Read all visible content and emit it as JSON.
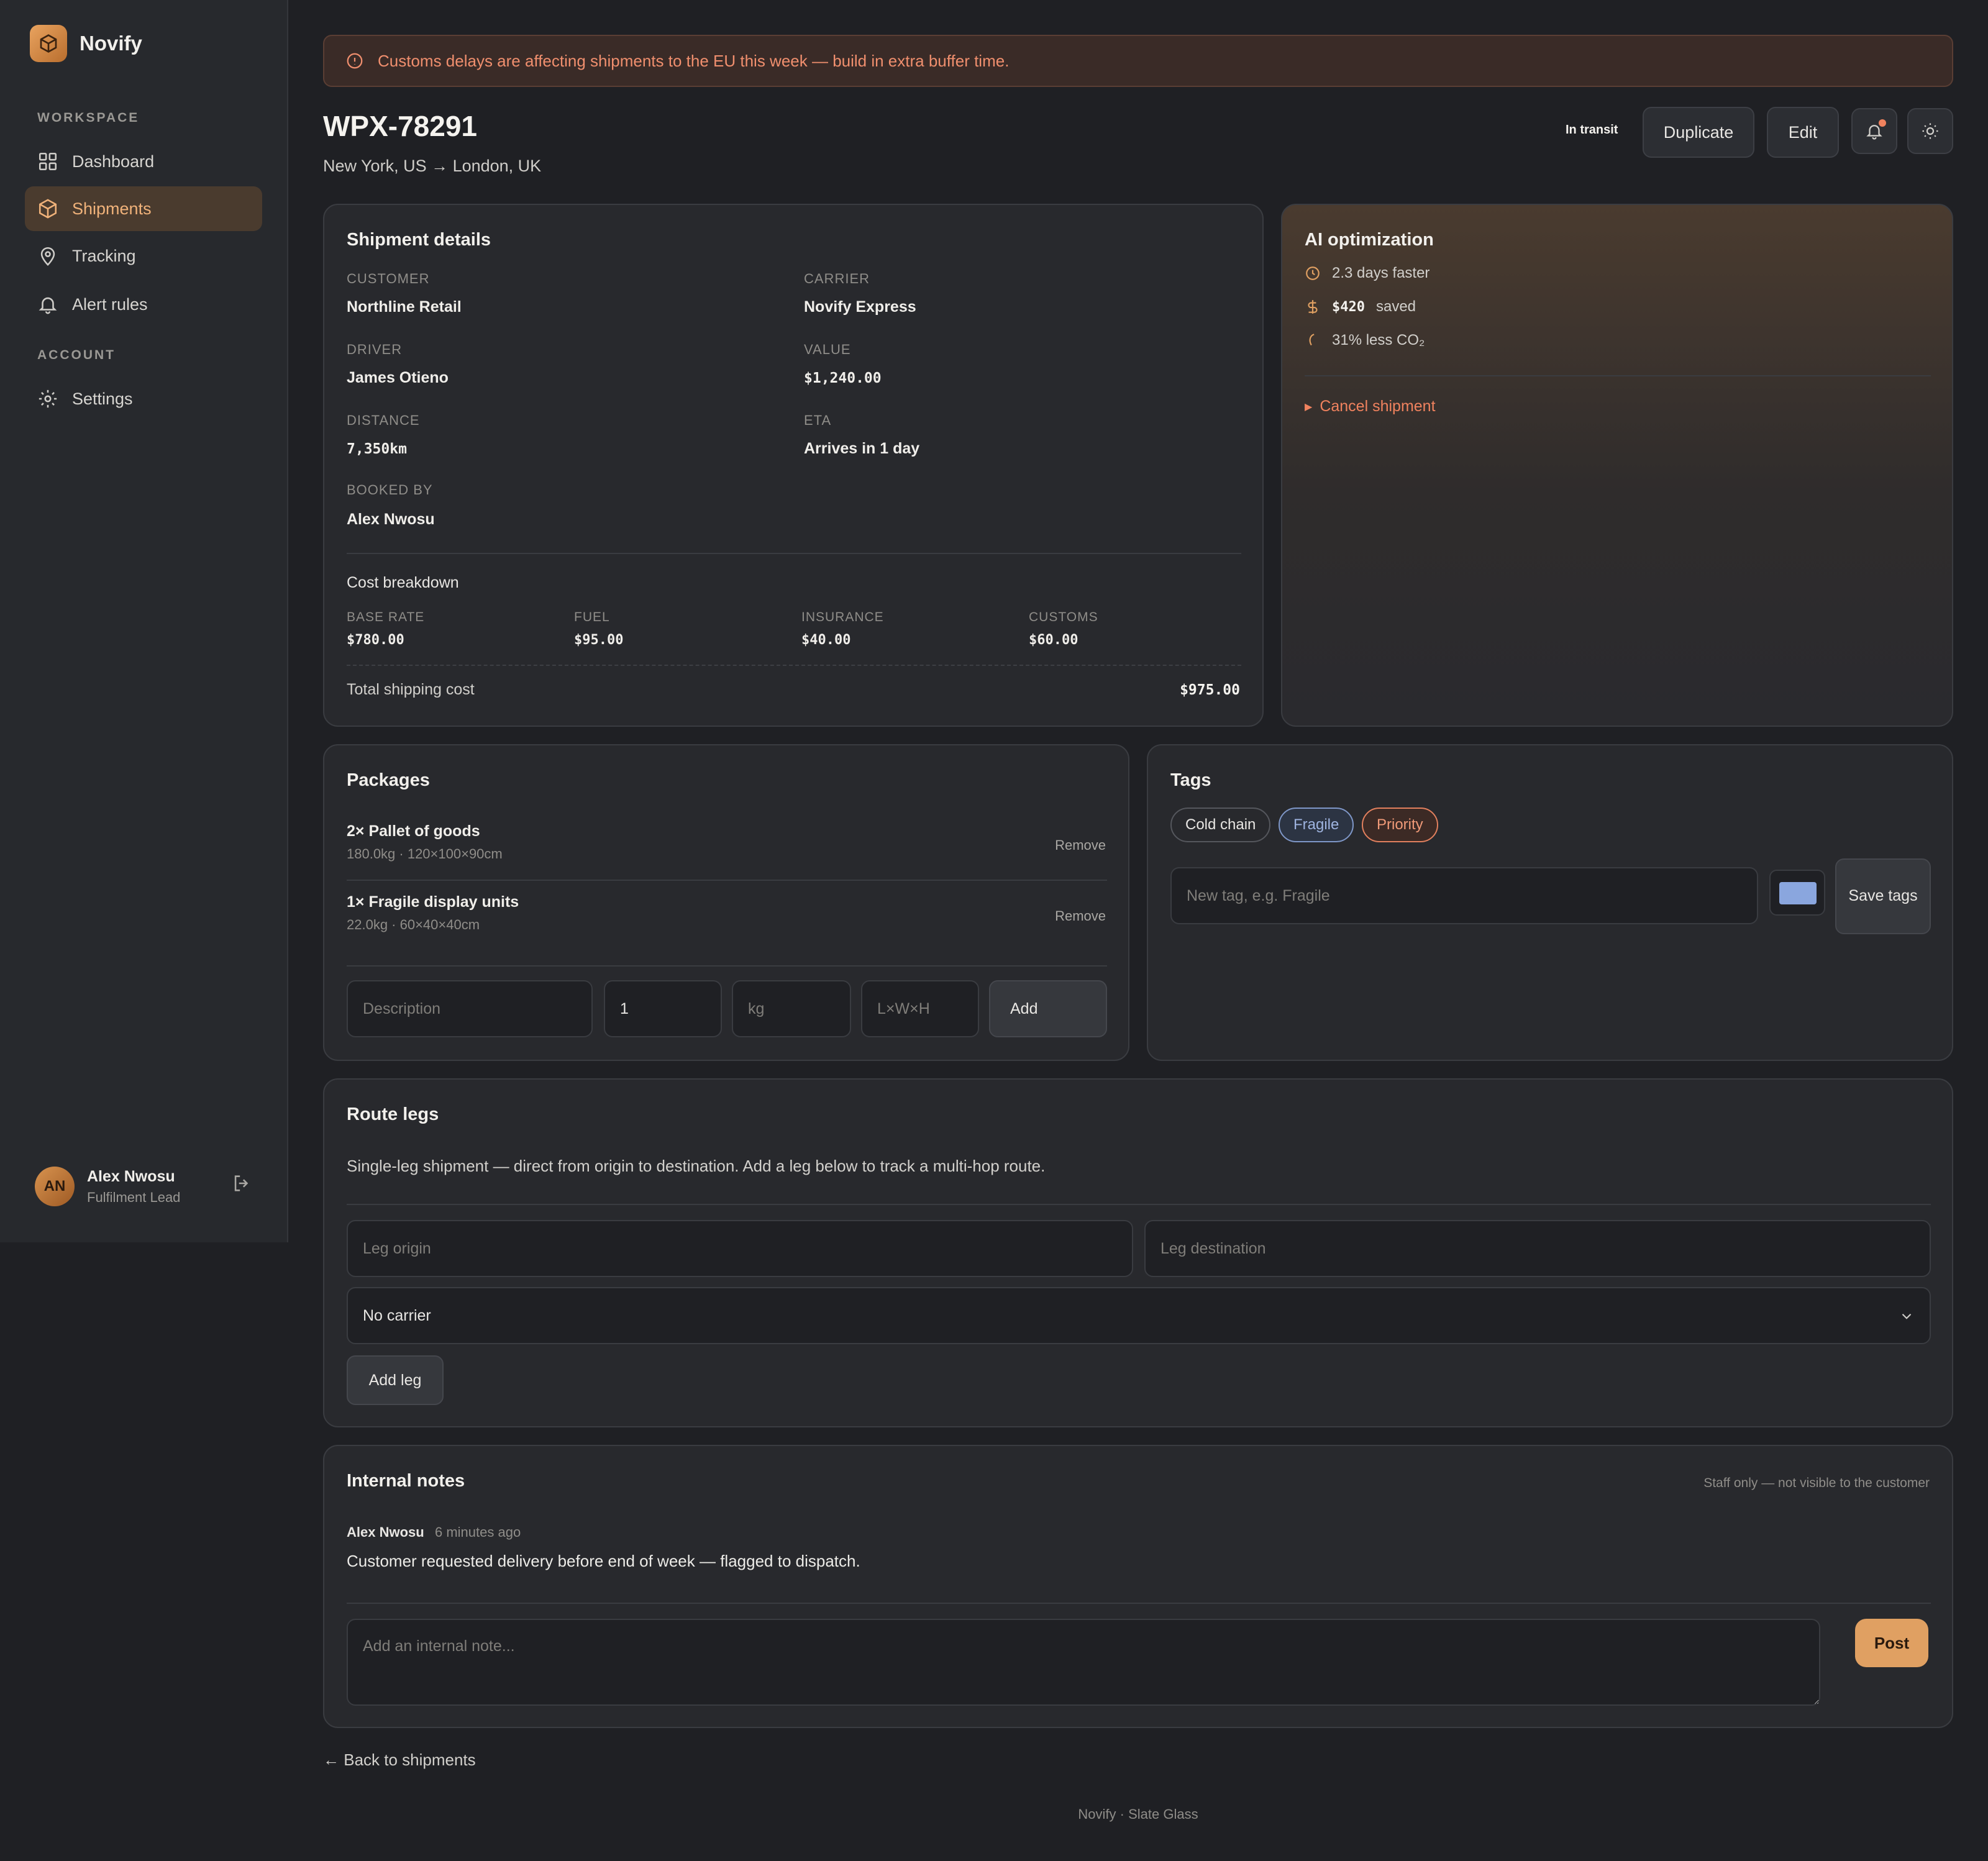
{
  "app": {
    "name": "Novify"
  },
  "sidebar": {
    "workspace_label": "WORKSPACE",
    "account_label": "ACCOUNT",
    "items": [
      {
        "label": "Dashboard",
        "icon": "grid-icon"
      },
      {
        "label": "Shipments",
        "icon": "box-icon",
        "active": true
      },
      {
        "label": "Tracking",
        "icon": "map-pin-icon"
      },
      {
        "label": "Alert rules",
        "icon": "bell-icon"
      }
    ],
    "account_items": [
      {
        "label": "Settings",
        "icon": "gear-icon"
      }
    ],
    "user": {
      "initials": "AN",
      "name": "Alex Nwosu",
      "role": "Fulfilment Lead"
    }
  },
  "alert": {
    "text": "Customs delays are affecting shipments to the EU this week — build in extra buffer time."
  },
  "header": {
    "title": "WPX-78291",
    "route": "New York, US → London, UK",
    "status": "In transit",
    "duplicate_label": "Duplicate",
    "edit_label": "Edit"
  },
  "details": {
    "title": "Shipment details",
    "customer_label": "CUSTOMER",
    "customer": "Northline Retail",
    "carrier_label": "CARRIER",
    "carrier": "Novify Express",
    "driver_label": "DRIVER",
    "driver": "James Otieno",
    "value_label": "VALUE",
    "value": "$1,240.00",
    "distance_label": "DISTANCE",
    "distance": "7,350km",
    "eta_label": "ETA",
    "eta": "Arrives in 1 day",
    "booked_label": "BOOKED BY",
    "booked": "Alex Nwosu",
    "cost_title": "Cost breakdown",
    "base_label": "BASE RATE",
    "base": "$780.00",
    "fuel_label": "FUEL",
    "fuel": "$95.00",
    "insurance_label": "INSURANCE",
    "insurance": "$40.00",
    "customs_label": "CUSTOMS",
    "customs": "$60.00",
    "total_label": "Total shipping cost",
    "total": "$975.00"
  },
  "ai": {
    "title": "AI optimization",
    "faster": "2.3 days faster",
    "saved_amount": "$420",
    "saved_label": "saved",
    "co2": "31% less CO₂",
    "cancel_label": "Cancel shipment"
  },
  "packages": {
    "title": "Packages",
    "items": [
      {
        "name": "2× Pallet of goods",
        "meta": "180.0kg · 120×100×90cm",
        "remove": "Remove"
      },
      {
        "name": "1× Fragile display units",
        "meta": "22.0kg · 60×40×40cm",
        "remove": "Remove"
      }
    ],
    "desc_placeholder": "Description",
    "qty_value": "1",
    "kg_placeholder": "kg",
    "dims_placeholder": "L×W×H",
    "add_label": "Add"
  },
  "tags": {
    "title": "Tags",
    "items": [
      "Cold chain",
      "Fragile",
      "Priority"
    ],
    "input_placeholder": "New tag, e.g. Fragile",
    "save_label": "Save tags",
    "swatch_color": "#8aa6de"
  },
  "route_legs": {
    "title": "Route legs",
    "description": "Single-leg shipment — direct from origin to destination. Add a leg below to track a multi-hop route.",
    "origin_placeholder": "Leg origin",
    "destination_placeholder": "Leg destination",
    "carrier_selected": "No carrier",
    "add_label": "Add leg"
  },
  "notes": {
    "title": "Internal notes",
    "hint": "Staff only — not visible to the customer",
    "author": "Alex Nwosu",
    "time": "6 minutes ago",
    "body": "Customer requested delivery before end of week — flagged to dispatch.",
    "placeholder": "Add an internal note...",
    "post_label": "Post"
  },
  "back_label": "← Back to shipments",
  "footer": "Novify · Slate Glass",
  "colors": {
    "accent": "#e0a062",
    "alert": "#f08f6e",
    "background": "#1f2024"
  }
}
